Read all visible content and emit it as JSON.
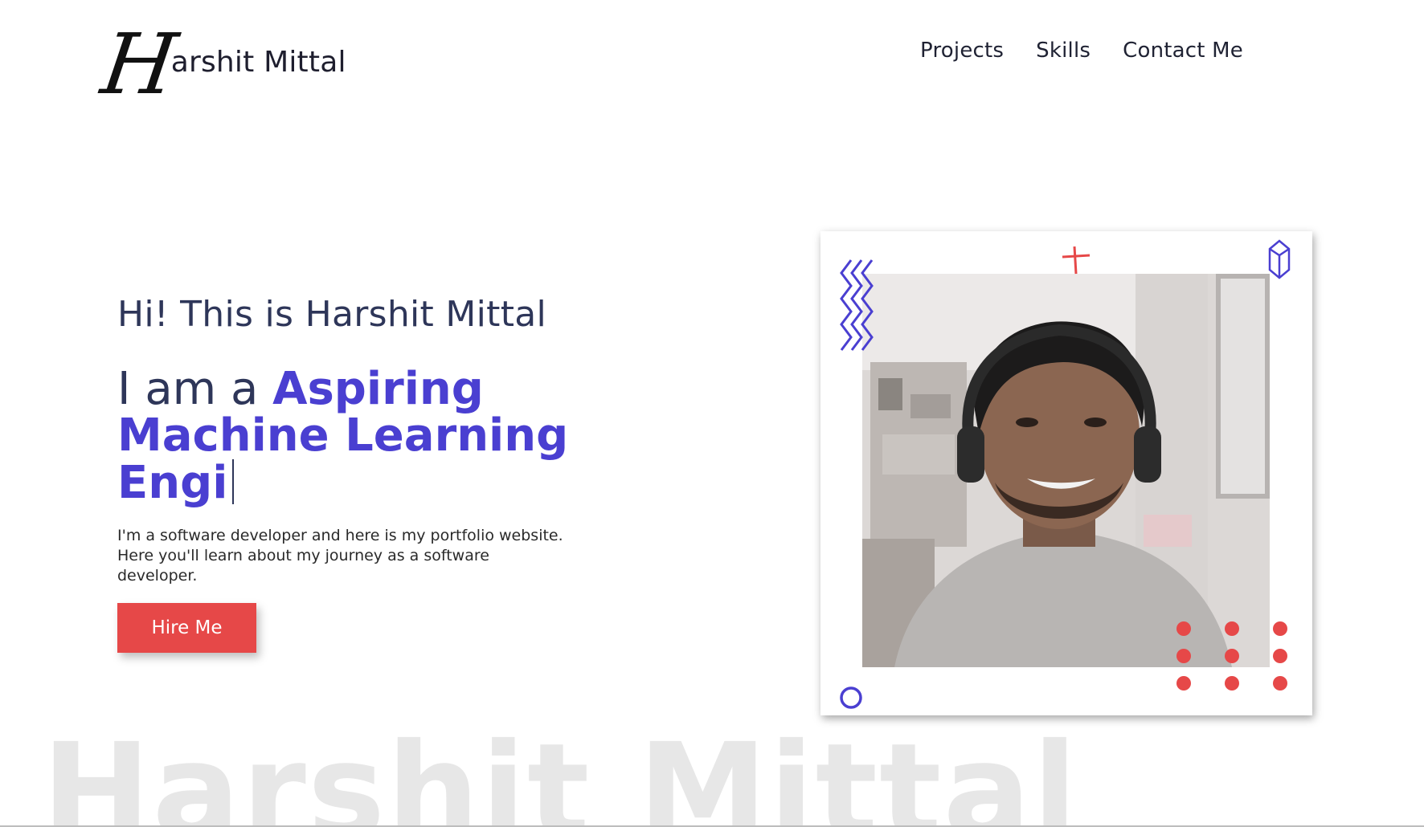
{
  "header": {
    "logo_mark": "H",
    "logo_text": "arshit Mittal",
    "nav": [
      "Projects",
      "Skills",
      "Contact Me"
    ]
  },
  "hero": {
    "greeting": "Hi! This is Harshit Mittal",
    "role_prefix": "I am a",
    "role_typed": "Aspiring Machine Learning Engi",
    "description": "I'm a software developer and here is my portfolio website. Here you'll learn about my journey as a software developer.",
    "cta_label": "Hire Me"
  },
  "watermark": "Harshit Mittal",
  "colors": {
    "accent": "#4a3fd1",
    "cta": "#e64848",
    "text": "#2e3659"
  }
}
